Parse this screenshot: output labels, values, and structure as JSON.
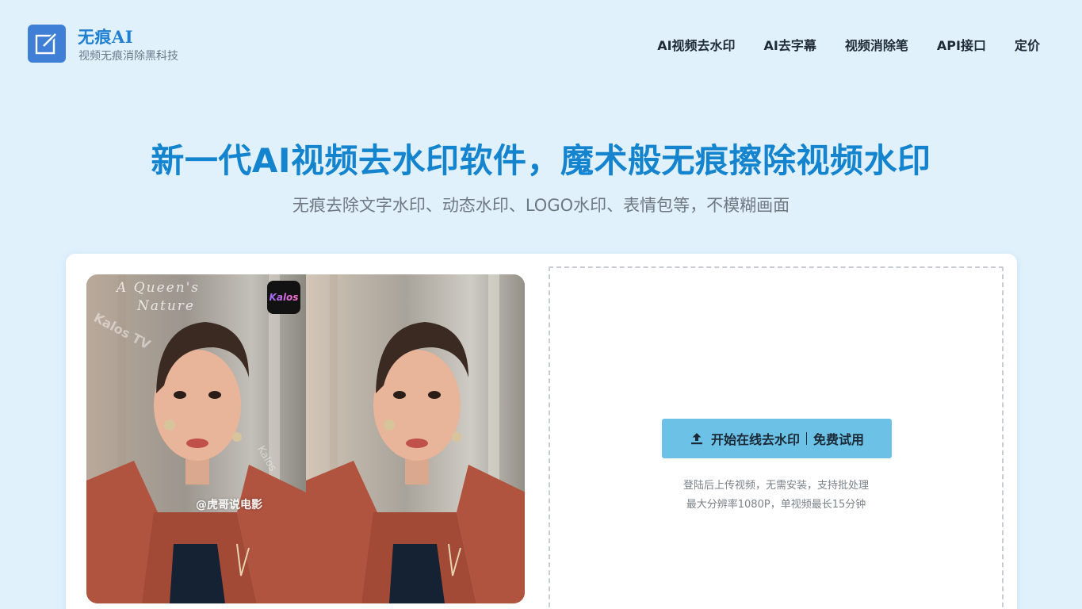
{
  "brand": {
    "name": "无痕AI",
    "tagline": "视频无痕消除黑科技",
    "accent_color": "#1f7fd0",
    "logo_icon": "edit-square-icon"
  },
  "nav": {
    "items": [
      {
        "label": "AI视频去水印"
      },
      {
        "label": "AI去字幕"
      },
      {
        "label": "视频消除笔"
      },
      {
        "label": "API接口"
      },
      {
        "label": "定价"
      }
    ]
  },
  "hero": {
    "title": "新一代AI视频去水印软件，魔术般无痕擦除视频水印",
    "subtitle": "无痕去除文字水印、动态水印、LOGO水印、表情包等，不模糊画面",
    "title_color": "#1484cf"
  },
  "preview": {
    "before": {
      "quote_watermark_line1": "A Queen's",
      "quote_watermark_line2": "Nature",
      "diagonal_watermark": "Kalos TV",
      "badge": "Kalos",
      "mid_watermark": "Kalos",
      "credit_watermark": "@虎哥说电影"
    }
  },
  "upload": {
    "button_main": "开始在线去水印",
    "button_secondary": "免费试用",
    "button_icon": "upload-icon",
    "button_color": "#6cc1e6",
    "note_line1": "登陆后上传视频，无需安装，支持批处理",
    "note_line2": "最大分辨率1080P，单视频最长15分钟"
  }
}
